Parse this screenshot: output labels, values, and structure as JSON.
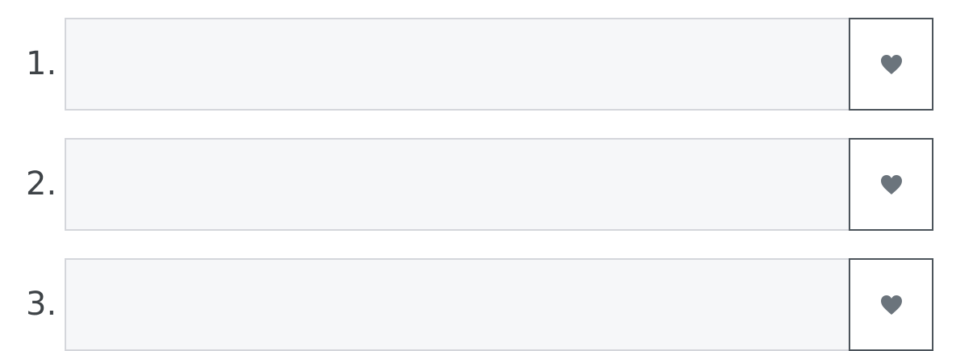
{
  "items": [
    {
      "number": "1.",
      "value": "",
      "icon": "heart-icon"
    },
    {
      "number": "2.",
      "value": "",
      "icon": "heart-icon"
    },
    {
      "number": "3.",
      "value": "",
      "icon": "heart-icon"
    }
  ],
  "colors": {
    "number_text": "#3e4347",
    "field_bg": "#f6f7f9",
    "field_border": "#d4d6db",
    "button_border": "#4c545b",
    "heart_fill": "#6b747c"
  }
}
